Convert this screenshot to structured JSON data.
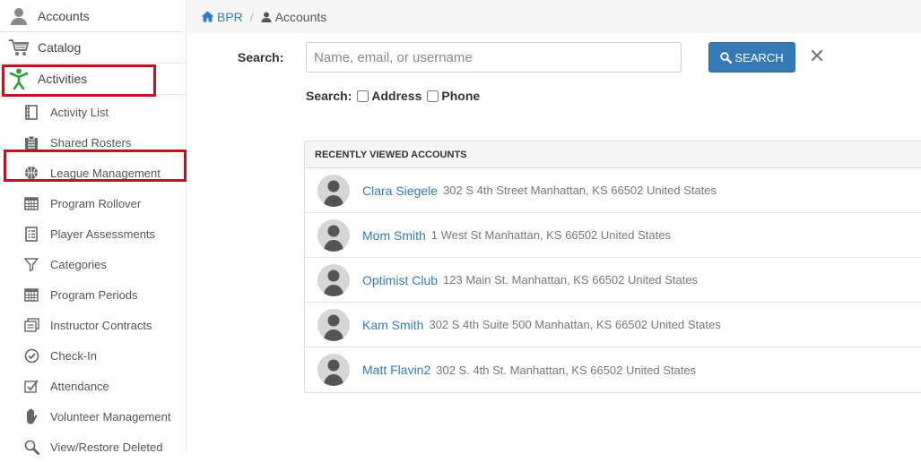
{
  "sidebar": {
    "top_items": [
      {
        "label": "Accounts",
        "icon": "user-icon"
      },
      {
        "label": "Catalog",
        "icon": "cart-icon"
      },
      {
        "label": "Activities",
        "icon": "person-activity-icon"
      }
    ],
    "sub_items": [
      {
        "label": "Activity List",
        "icon": "notebook-icon"
      },
      {
        "label": "Shared Rosters",
        "icon": "clipboard-icon"
      },
      {
        "label": "League Management",
        "icon": "basketball-icon"
      },
      {
        "label": "Program Rollover",
        "icon": "calendar-icon"
      },
      {
        "label": "Player Assessments",
        "icon": "assessment-icon"
      },
      {
        "label": "Categories",
        "icon": "filter-icon"
      },
      {
        "label": "Program Periods",
        "icon": "calendar-icon"
      },
      {
        "label": "Instructor Contracts",
        "icon": "contracts-icon"
      },
      {
        "label": "Check-In",
        "icon": "check-circle-icon"
      },
      {
        "label": "Attendance",
        "icon": "attendance-icon"
      },
      {
        "label": "Volunteer Management",
        "icon": "hand-icon"
      },
      {
        "label": "View/Restore Deleted",
        "icon": "magnifier-icon"
      }
    ]
  },
  "breadcrumb": {
    "home": "BPR",
    "separator": "/",
    "current": "Accounts"
  },
  "search": {
    "label": "Search:",
    "placeholder": "Name, email, or username",
    "value": "",
    "button_label": "SEARCH",
    "clear_glyph": "✕",
    "filter_label": "Search:",
    "filters": [
      {
        "label": "Address",
        "checked": false
      },
      {
        "label": "Phone",
        "checked": false
      }
    ]
  },
  "recent": {
    "title": "RECENTLY VIEWED ACCOUNTS",
    "accounts": [
      {
        "name": "Clara Siegele",
        "address": "302 S 4th Street Manhattan, KS 66502 United States"
      },
      {
        "name": "Mom Smith",
        "address": "1 West St Manhattan, KS 66502 United States"
      },
      {
        "name": "Optimist Club",
        "address": "123 Main St. Manhattan, KS 66502 United States"
      },
      {
        "name": "Kam Smith",
        "address": "302 S 4th Suite 500 Manhattan, KS 66502 United States"
      },
      {
        "name": "Matt Flavin2",
        "address": "302 S. 4th St. Manhattan, KS 66502 United States"
      }
    ]
  },
  "colors": {
    "link": "#337ab7",
    "highlight": "#c1121f",
    "activities_icon": "#2e9e3a"
  }
}
